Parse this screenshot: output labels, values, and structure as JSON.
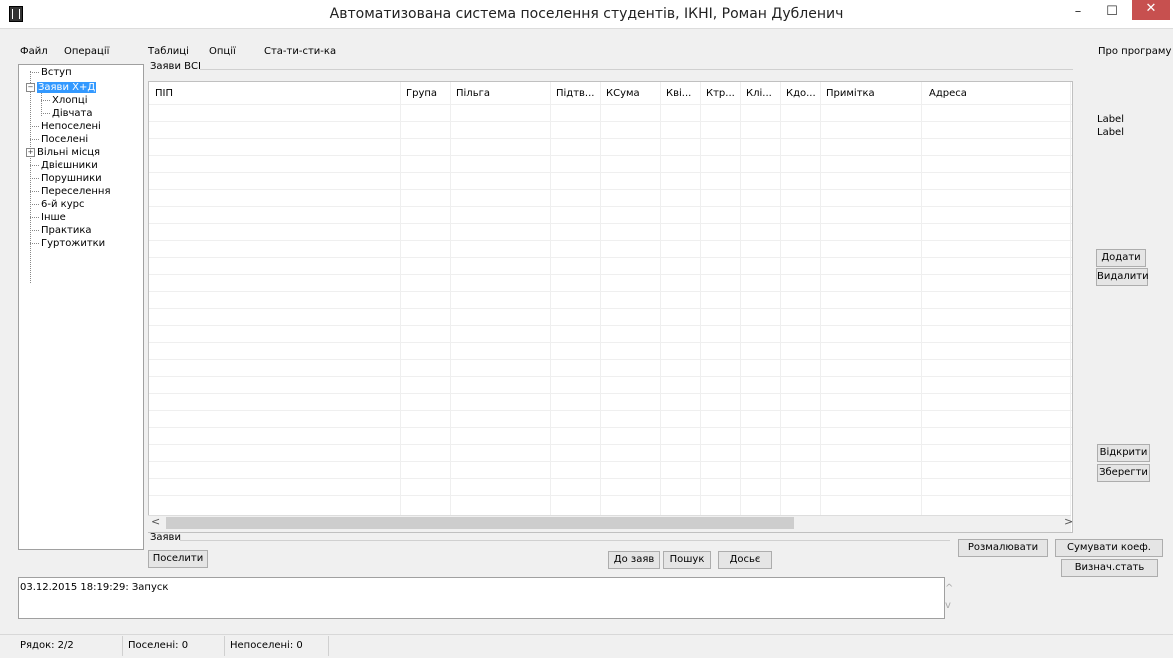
{
  "window": {
    "title": "Автоматизована система поселення студентів, ІКНІ, Роман Дубленич",
    "minimize": "–",
    "maximize": "☐",
    "close": "✕"
  },
  "menu": {
    "items": [
      "Файл",
      "Операції",
      "Таблиці",
      "Опції",
      "Ста-ти-сти-ка"
    ],
    "right_item": "Про програму"
  },
  "tree": {
    "items": [
      "Вступ",
      "Заяви Х+Д",
      "Хлопці",
      "Дівчата",
      "Непоселені",
      "Поселені",
      "Вільні місця",
      "Двієшники",
      "Порушники",
      "Переселення",
      "6-й курс",
      "Інше",
      "Практика",
      "Гуртожитки"
    ],
    "selected": "Заяви Х+Д",
    "expander_minus": "−",
    "expander_plus": "+"
  },
  "grid": {
    "group_title": "Заяви ВСІ",
    "columns": [
      "ПІП",
      "Група",
      "Пільга",
      "Підтв...",
      "КСума",
      "Кві...",
      "Ктр...",
      "Клі...",
      "Кдо...",
      "Примітка",
      "Адреса"
    ],
    "scroll_left": "<",
    "scroll_right": ">"
  },
  "right_panel": {
    "label1": "Label",
    "label2": "Label",
    "add_button": "Додати",
    "delete_button": "Видалити",
    "open_button": "Відкрити",
    "save_button": "Зберегти"
  },
  "bottom": {
    "group_title": "Заяви",
    "settle_button": "Поселити",
    "to_applications_button": "До заяв",
    "search_button": "Пошук",
    "dossier_button": "Досьє",
    "paint_button": "Розмалювати",
    "sum_coef_button": "Сумувати коеф.",
    "determine_stat_button": "Визнач.стать"
  },
  "log": {
    "text": "03.12.2015  18:19:29: Запуск",
    "scroll_up": "^",
    "scroll_down": "v"
  },
  "status": {
    "row": "Рядок: 2/2",
    "settled": "Поселені: 0",
    "unsettled": "Непоселені: 0"
  }
}
